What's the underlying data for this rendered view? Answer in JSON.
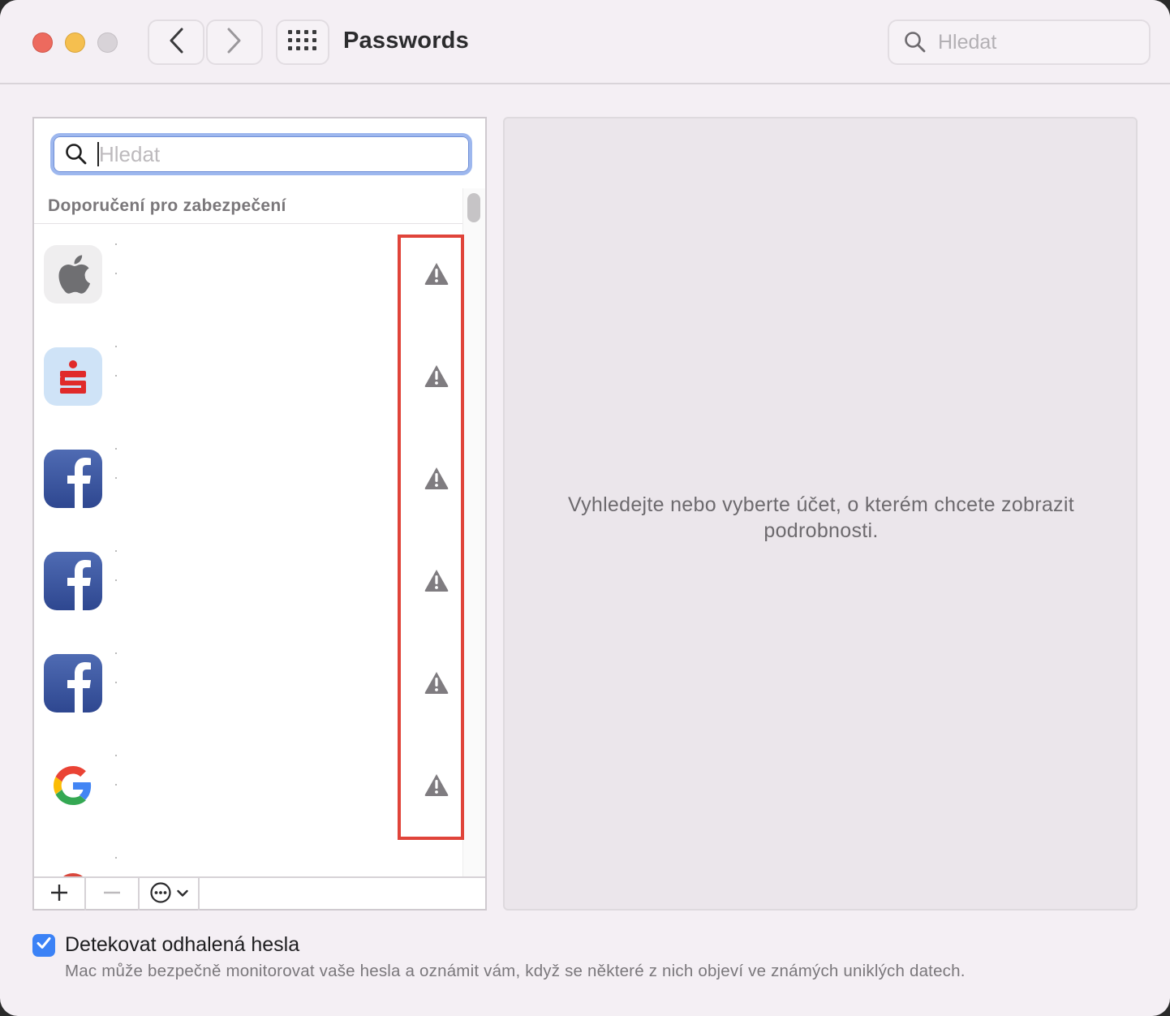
{
  "window": {
    "title": "Passwords",
    "search_placeholder": "Hledat"
  },
  "list": {
    "search_placeholder": "Hledat",
    "section_header": "Doporučení pro zabezpečení",
    "items": [
      {
        "icon": "apple-icon"
      },
      {
        "icon": "bank-icon"
      },
      {
        "icon": "facebook-icon"
      },
      {
        "icon": "facebook-icon"
      },
      {
        "icon": "facebook-icon"
      },
      {
        "icon": "google-icon"
      },
      {
        "icon": "generic-red-icon"
      }
    ],
    "warning_icon": "warning-triangle-icon"
  },
  "detail": {
    "message": "Vyhledejte nebo vyberte účet, o kterém chcete zobrazit podrobnosti."
  },
  "settings": {
    "detect_label": "Detekovat odhalená hesla",
    "detect_checked": true,
    "detect_description": "Mac může bezpečně monitorovat vaše hesla a oznámit vám, když se některé z nich objeví ve známých uniklých datech."
  },
  "colors": {
    "accent": "#3b82f6",
    "highlight": "#e0443a"
  }
}
